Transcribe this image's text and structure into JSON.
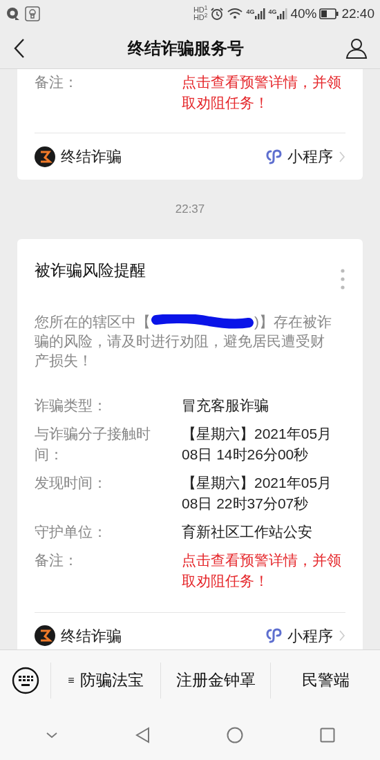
{
  "status_bar": {
    "hd_labels": [
      "HD$^{1}$",
      "HD$^{2}$"
    ],
    "network_labels": [
      "4G",
      "4G"
    ],
    "battery": "40%",
    "time": "22:40"
  },
  "header": {
    "title": "终结诈骗服务号"
  },
  "messages": [
    {
      "kind": "partial",
      "fields": [
        {
          "label": "备注：",
          "value": "点击查看预警详情，并领取劝阻任务！",
          "highlight": true
        }
      ],
      "app_name": "终结诈骗",
      "app_tag": "小程序"
    },
    {
      "kind": "timestamp",
      "time": "22:37"
    },
    {
      "kind": "full",
      "title": "被诈骗风险提醒",
      "body_before": "您所在的辖区中【",
      "redacted": true,
      "body_after": ")】存在被诈骗的风险，请及时进行劝阻，避免居民遭受财产损失！",
      "fields": [
        {
          "label": "诈骗类型：",
          "value": "冒充客服诈骗",
          "highlight": false
        },
        {
          "label": "与诈骗分子接触时间：",
          "value": "【星期六】2021年05月08日 14时26分00秒",
          "highlight": false
        },
        {
          "label": "发现时间：",
          "value": "【星期六】2021年05月08日 22时37分07秒",
          "highlight": false
        },
        {
          "label": "守护单位：",
          "value": "育新社区工作站公安",
          "highlight": false
        },
        {
          "label": "备注：",
          "value": "点击查看预警详情，并领取劝阻任务！",
          "highlight": true
        }
      ],
      "app_name": "终结诈骗",
      "app_tag": "小程序"
    }
  ],
  "menu": [
    {
      "label": "防骗法宝",
      "glyph": "≡"
    },
    {
      "label": "注册金钟罩"
    },
    {
      "label": "民警端"
    }
  ]
}
